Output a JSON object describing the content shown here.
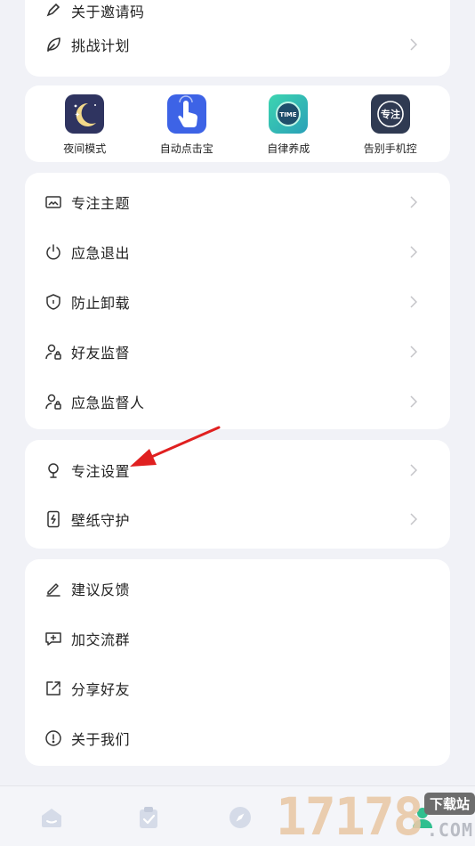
{
  "top_card": {
    "partial_label": "关于邀请码",
    "challenge_label": "挑战计划"
  },
  "tools": [
    {
      "label": "夜间模式",
      "icon": "moon-icon",
      "bg": "#2f3460"
    },
    {
      "label": "自动点击宝",
      "icon": "hand-tap-icon",
      "bg": "#3d63e6"
    },
    {
      "label": "自律养成",
      "icon": "time-icon",
      "bg": "#34c1a2",
      "badge": "TIME"
    },
    {
      "label": "告别手机控",
      "icon": "focus-icon",
      "bg": "#2f3a52",
      "badge": "专注"
    }
  ],
  "settings_group_1": [
    {
      "label": "专注主题",
      "icon": "image-icon"
    },
    {
      "label": "应急退出",
      "icon": "power-icon"
    },
    {
      "label": "防止卸载",
      "icon": "shield-icon"
    },
    {
      "label": "好友监督",
      "icon": "user-lock-icon"
    },
    {
      "label": "应急监督人",
      "icon": "user-lock-icon"
    }
  ],
  "settings_group_2": [
    {
      "label": "专注设置",
      "icon": "bulb-icon"
    },
    {
      "label": "壁纸守护",
      "icon": "phone-bolt-icon"
    }
  ],
  "settings_group_3": [
    {
      "label": "建议反馈",
      "icon": "pencil-icon"
    },
    {
      "label": "加交流群",
      "icon": "chat-plus-icon"
    },
    {
      "label": "分享好友",
      "icon": "share-icon"
    },
    {
      "label": "关于我们",
      "icon": "info-icon"
    }
  ],
  "bottom_nav": [
    {
      "icon": "home-icon"
    },
    {
      "icon": "clipboard-icon"
    },
    {
      "icon": "compass-icon"
    },
    {
      "icon": "profile-icon"
    }
  ],
  "watermark": {
    "number": "17178",
    "tag": "下载站",
    "suffix": ".COM"
  },
  "colors": {
    "background": "#f1f2f7",
    "card": "#ffffff",
    "arrow": "#e02020",
    "icon_stroke": "#333333",
    "chevron": "#c4c4c8"
  }
}
